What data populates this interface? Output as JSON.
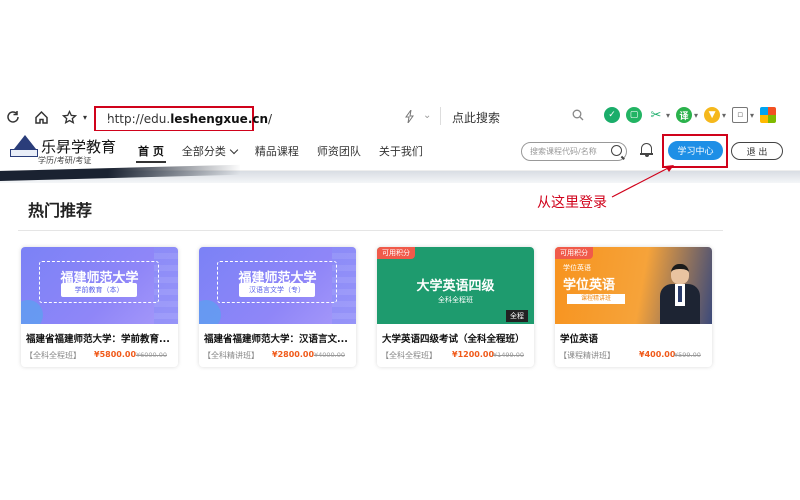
{
  "browser": {
    "url_prefix": "http://edu.",
    "url_domain": "leshengxue.cn",
    "url_suffix": "/",
    "search_placeholder": "点此搜索"
  },
  "site": {
    "logo_title": "乐昇学教育",
    "logo_subtitle": "学历/考研/考证",
    "nav": [
      {
        "label": "首 页",
        "active": true
      },
      {
        "label": "全部分类",
        "dropdown": true
      },
      {
        "label": "精品课程"
      },
      {
        "label": "师资团队"
      },
      {
        "label": "关于我们"
      }
    ],
    "search_placeholder": "搜索课程代码/名称",
    "study_center": "学习中心",
    "logout": "退 出"
  },
  "annotation": {
    "text": "从这里登录",
    "color": "#d0021b"
  },
  "section": {
    "title": "热门推荐"
  },
  "cards": [
    {
      "thumb_title": "福建师范大学",
      "thumb_sub": "学前教育（本）",
      "title": "福建省福建师范大学：学前教育...",
      "category": "【全科全程班】",
      "price": "¥5800.00",
      "old_price": "¥6000.00"
    },
    {
      "thumb_title": "福建师范大学",
      "thumb_sub": "汉语言文学（专）",
      "title": "福建省福建师范大学：汉语言文...",
      "category": "【全科精讲班】",
      "price": "¥2800.00",
      "old_price": "¥4000.00"
    },
    {
      "badge": "可用积分",
      "thumb_title": "大学英语四级",
      "thumb_sub": "全科全程班",
      "thumb_tag": "全程",
      "title": "大学英语四级考试（全科全程班）",
      "category": "【全科全程班】",
      "price": "¥1200.00",
      "old_price": "¥1499.00"
    },
    {
      "badge": "可用积分",
      "thumb_small": "学位英语",
      "thumb_title": "学位英语",
      "thumb_sub": "课程精讲班",
      "title": "学位英语",
      "category": "【课程精讲班】",
      "price": "¥400.00",
      "old_price": "¥599.00"
    }
  ],
  "colors": {
    "accent_blue": "#1e8fe6",
    "highlight_red": "#d0021b",
    "price_orange": "#f05a1a"
  }
}
